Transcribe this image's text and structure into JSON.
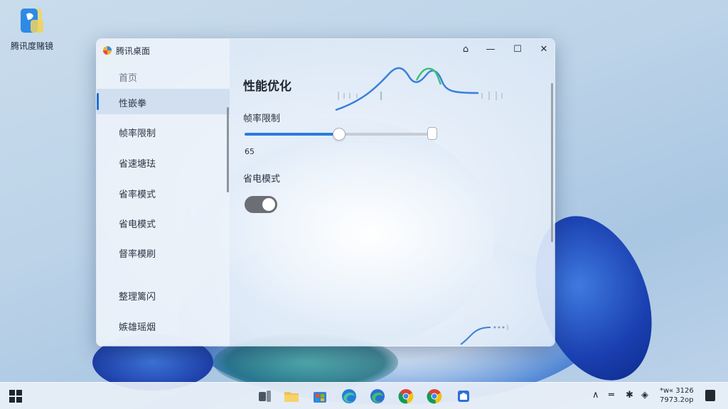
{
  "desktop": {
    "icon_label": "腾讯度赌镜"
  },
  "window": {
    "title": "腾讯桌面",
    "controls": {
      "pin": "⌂",
      "minimize": "—",
      "maximize": "☐",
      "close": "✕"
    }
  },
  "sidebar": {
    "items": [
      {
        "label": "首页",
        "state": "muted"
      },
      {
        "label": "性嵌拳",
        "state": "active"
      },
      {
        "label": "帧率限制",
        "state": "normal"
      },
      {
        "label": "省速塘珐",
        "state": "normal"
      },
      {
        "label": "省率模式",
        "state": "normal"
      },
      {
        "label": "省电模式",
        "state": "normal"
      },
      {
        "label": "督率模刷",
        "state": "normal"
      },
      {
        "label": "整理篱闪",
        "state": "normal"
      },
      {
        "label": "嫉雄瑶烟",
        "state": "normal"
      }
    ]
  },
  "content": {
    "title": "性能优化",
    "framerate": {
      "label": "帧率限制",
      "value": "65",
      "fraction": 0.5
    },
    "power_saving": {
      "label": "省电模式",
      "enabled": true
    }
  },
  "taskbar": {
    "clock_line1": "*w« 3126",
    "clock_line2": "7973.2op"
  },
  "colors": {
    "accent": "#1f6fd6",
    "toggle_on": "#6b6f75"
  }
}
